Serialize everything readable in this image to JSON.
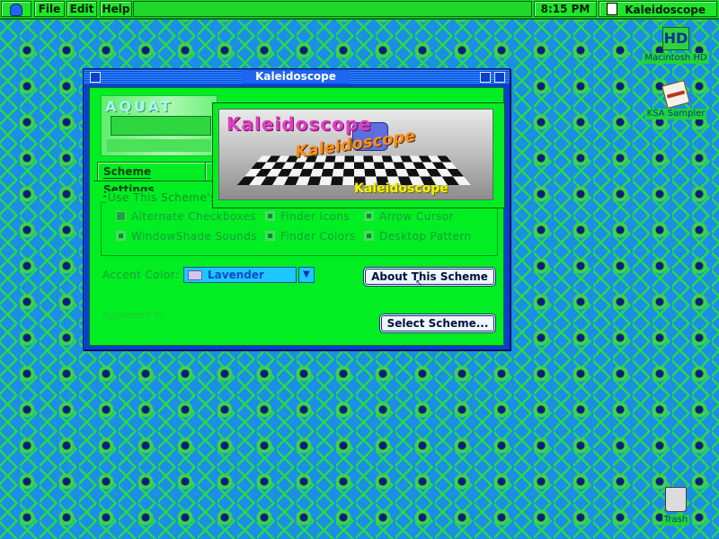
{
  "menubar": {
    "menus": [
      "File",
      "Edit",
      "Help"
    ],
    "clock": "8:15 PM",
    "active_app": "Kaleidoscope"
  },
  "desktop": {
    "icons": [
      {
        "label": "Macintosh HD",
        "icon": "hard-disk-icon"
      },
      {
        "label": "KSA Sampler",
        "icon": "application-icon"
      },
      {
        "label": "Trash",
        "icon": "trash-icon"
      }
    ]
  },
  "window": {
    "title": "Kaleidoscope",
    "logo_text": "AQUAT",
    "tabs": [
      "Scheme Settings"
    ],
    "group_title": "Use This Scheme's:",
    "options": [
      {
        "label": "Alternate Checkboxes",
        "checked": false
      },
      {
        "label": "Finder Icons",
        "checked": true
      },
      {
        "label": "Arrow Cursor",
        "checked": true
      },
      {
        "label": "WindowShade Sounds",
        "checked": true
      },
      {
        "label": "Finder Colors",
        "checked": true
      },
      {
        "label": "Desktop Pattern",
        "checked": true
      }
    ],
    "accent_label": "Accent Color:",
    "accent_value": "Lavender",
    "about_button": "About This Scheme",
    "select_button": "Select Scheme...",
    "registered_label": "Registered To:"
  },
  "splash": {
    "title_top": "Kaleidoscope",
    "title_script": "Kaleidoscope",
    "caption": "Kaleidoscope"
  },
  "colors": {
    "desktop": "#1c8ee6",
    "menubar": "#12e01f",
    "window_frame": "#0b3fcf",
    "content": "#00ee22"
  }
}
